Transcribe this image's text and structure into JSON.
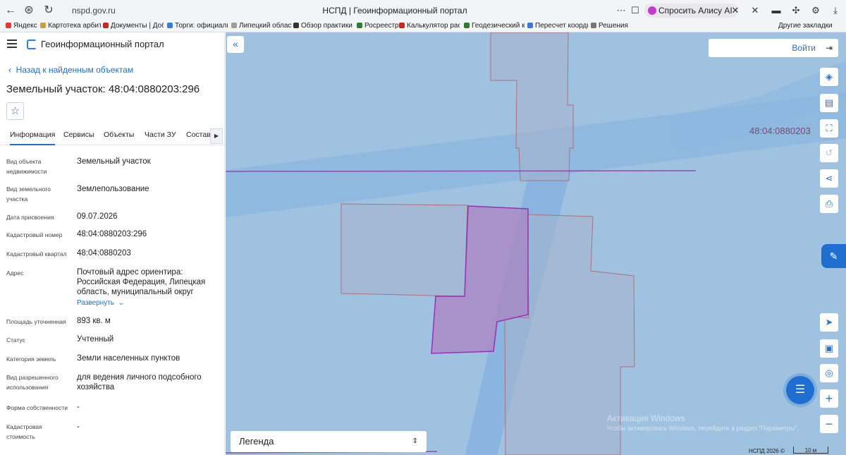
{
  "browser": {
    "url": "nspd.gov.ru",
    "tab_title": "НСПД | Геоинформационный портал",
    "ask_alice": "Спросить Алису AI",
    "other_bookmarks": "Другие закладки",
    "bookmarks": [
      {
        "label": "Яндекс",
        "color": "#e53935"
      },
      {
        "label": "Картотека арбитр",
        "color": "#c8a040"
      },
      {
        "label": "Документы | Доб",
        "color": "#c62828"
      },
      {
        "label": "Торги: официаль",
        "color": "#3a7bd5"
      },
      {
        "label": "Липецкий област",
        "color": "#9e9e9e"
      },
      {
        "label": "Обзор практики",
        "color": "#333333"
      },
      {
        "label": "Росреестр",
        "color": "#2e7d32"
      },
      {
        "label": "Калькулятор рас",
        "color": "#c62828"
      },
      {
        "label": "Геодезический к",
        "color": "#2e7d32"
      },
      {
        "label": "Пересчет коорди",
        "color": "#3a7bd5"
      },
      {
        "label": "Решения",
        "color": "#777777"
      }
    ]
  },
  "app": {
    "title": "Геоинформационный портал",
    "back_link": "Назад к найденным объектам",
    "object_title": "Земельный участок: 48:04:0880203:296",
    "tabs": [
      "Информация",
      "Сервисы",
      "Объекты",
      "Части ЗУ",
      "Состав"
    ],
    "properties": [
      {
        "label": "Вид объекта недвижимости",
        "value": "Земельный участок"
      },
      {
        "label": "Вид земельного участка",
        "value": "Землепользование"
      },
      {
        "label": "Дата присвоения",
        "value": "09.07.2026"
      },
      {
        "label": "Кадастровый номер",
        "value": "48:04:0880203:296"
      },
      {
        "label": "Кадастровый квартал",
        "value": "48:04:0880203"
      },
      {
        "label": "Адрес",
        "value": "Почтовый адрес ориентира: Российская Федерация, Липецкая область, муниципальный округ"
      },
      {
        "label": "Площадь уточненная",
        "value": "893 кв. м"
      },
      {
        "label": "Статус",
        "value": "Учтенный"
      },
      {
        "label": "Категория земель",
        "value": "Земли населенных пунктов"
      },
      {
        "label": "Вид разрешенного использования",
        "value": "для ведения личного подсобного хозяйства"
      },
      {
        "label": "Форма собственности",
        "value": "-"
      },
      {
        "label": "Кадастровая стоимость",
        "value": "-"
      }
    ],
    "expand_label": "Развернуть"
  },
  "map": {
    "login": "Войти",
    "cadastral_label": "48:04:0880203",
    "legend": "Легенда",
    "watermark_title": "Активация Windows",
    "watermark_text": "Чтобы активировать Windows, перейдите в раздел \"Параметры\".",
    "copyright": "НСПД 2026 ©",
    "scale": "10 м",
    "colors": {
      "background": "#9fc2e1",
      "road": "#7fb1de",
      "parcel_outline": "#b0707a",
      "selected_fill": "#a98ac4",
      "selected_outline": "#9a2fb8"
    }
  }
}
